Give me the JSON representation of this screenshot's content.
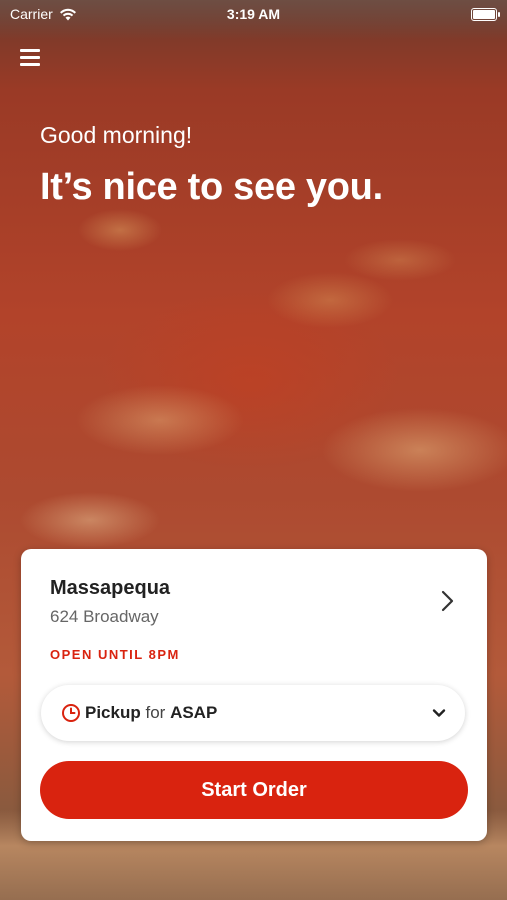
{
  "status_bar": {
    "carrier": "Carrier",
    "time": "3:19 AM",
    "battery_level": 1.0
  },
  "header": {
    "greeting": "Good morning!",
    "headline": "It’s nice to see you."
  },
  "store": {
    "name": "Massapequa",
    "address": "624 Broadway",
    "hours": "OPEN UNTIL 8PM"
  },
  "pickup": {
    "mode": "Pickup",
    "connector": "for",
    "time": "ASAP"
  },
  "actions": {
    "start_order": "Start Order"
  },
  "icons": {
    "menu": "hamburger-menu-icon",
    "wifi": "wifi-icon",
    "battery": "battery-icon",
    "chevron_right": "chevron-right-icon",
    "clock": "clock-icon",
    "chevron_down": "chevron-down-icon"
  },
  "colors": {
    "accent": "#d9230f",
    "text_primary": "#222222",
    "text_secondary": "#666666",
    "card_bg": "#ffffff"
  }
}
